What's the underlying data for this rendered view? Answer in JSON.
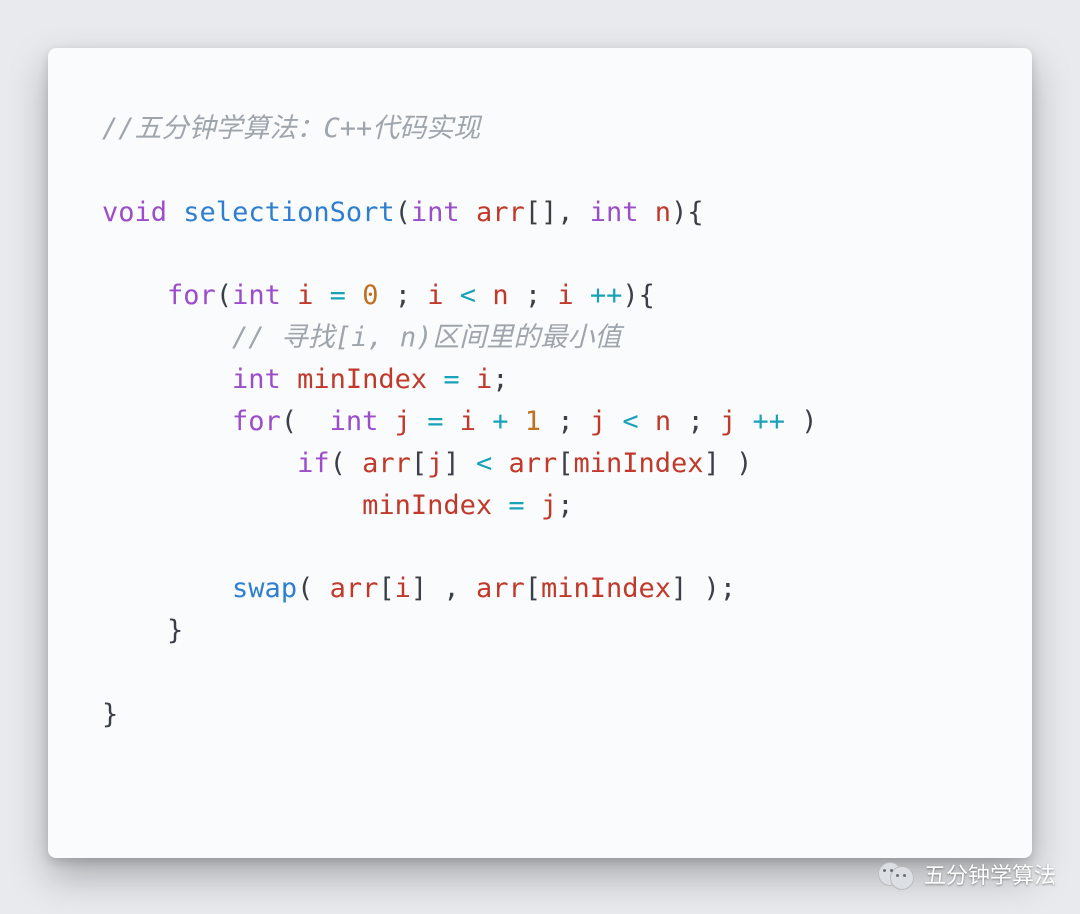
{
  "code": {
    "comment_top": "//五分钟学算法：C++代码实现",
    "kw_void": "void",
    "fn_name": "selectionSort",
    "kw_int1": "int",
    "id_arr1": "arr",
    "kw_int2": "int",
    "id_n1": "n",
    "kw_for1": "for",
    "kw_int3": "int",
    "id_i1": "i",
    "num_0": "0",
    "id_i2": "i",
    "id_n2": "n",
    "id_i3": "i",
    "comment_inner": "// 寻找[i, n)区间里的最小值",
    "kw_int4": "int",
    "id_min1": "minIndex",
    "id_i4": "i",
    "kw_for2": "for",
    "kw_int5": "int",
    "id_j1": "j",
    "id_i5": "i",
    "num_1": "1",
    "id_j2": "j",
    "id_n3": "n",
    "id_j3": "j",
    "kw_if": "if",
    "id_arr2": "arr",
    "id_j4": "j",
    "id_arr3": "arr",
    "id_min2": "minIndex",
    "id_min3": "minIndex",
    "id_j5": "j",
    "fn_swap": "swap",
    "id_arr4": "arr",
    "id_i6": "i",
    "id_arr5": "arr",
    "id_min4": "minIndex",
    "op_eq": "=",
    "op_lt": "<",
    "op_plus": "+",
    "op_pp": "++"
  },
  "watermark": {
    "text": "五分钟学算法"
  }
}
